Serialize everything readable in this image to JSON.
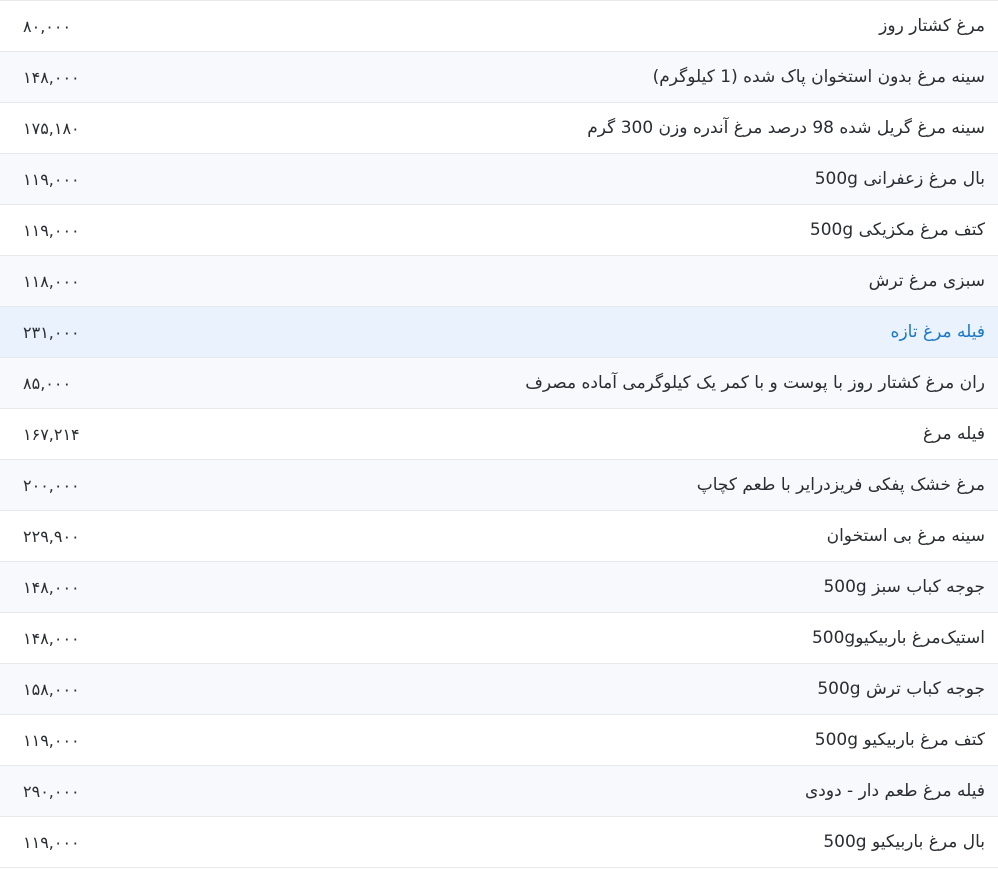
{
  "items": [
    {
      "name": "مرغ کشتار روز",
      "price": "۸۰,۰۰۰"
    },
    {
      "name": "سینه مرغ بدون استخوان پاک شده (1 کیلوگرم)",
      "price": "۱۴۸,۰۰۰"
    },
    {
      "name": "سینه مرغ گریل شده 98 درصد مرغ آندره وزن 300 گرم",
      "price": "۱۷۵,۱۸۰"
    },
    {
      "name": "بال مرغ زعفرانی 500g",
      "price": "۱۱۹,۰۰۰"
    },
    {
      "name": "کتف مرغ مکزیکی 500g",
      "price": "۱۱۹,۰۰۰"
    },
    {
      "name": "سبزی مرغ ترش",
      "price": "۱۱۸,۰۰۰"
    },
    {
      "name": "فیله مرغ تازه",
      "price": "۲۳۱,۰۰۰"
    },
    {
      "name": "ران مرغ کشتار روز با پوست و با کمر یک کیلوگرمی آماده مصرف",
      "price": "۸۵,۰۰۰"
    },
    {
      "name": "فیله مرغ",
      "price": "۱۶۷,۲۱۴"
    },
    {
      "name": "مرغ خشک پفکی فریزدرایر با طعم کچاپ",
      "price": "۲۰۰,۰۰۰"
    },
    {
      "name": "سینه مرغ بی استخوان",
      "price": "۲۲۹,۹۰۰"
    },
    {
      "name": "جوجه کباب سبز 500g",
      "price": "۱۴۸,۰۰۰"
    },
    {
      "name": "استیک‌مرغ باربیکیو500g",
      "price": "۱۴۸,۰۰۰"
    },
    {
      "name": "جوجه کباب ترش 500g",
      "price": "۱۵۸,۰۰۰"
    },
    {
      "name": "کتف مرغ باربیکیو 500g",
      "price": "۱۱۹,۰۰۰"
    },
    {
      "name": "فیله مرغ طعم دار - دودی",
      "price": "۲۹۰,۰۰۰"
    },
    {
      "name": "بال مرغ باربیکیو 500g",
      "price": "۱۱۹,۰۰۰"
    }
  ],
  "colors": {
    "highlight_background": "#eaf3fd",
    "highlight_text": "#1b78c9",
    "stripe_background": "#f7f9fc",
    "divider": "#e7e9ee"
  }
}
